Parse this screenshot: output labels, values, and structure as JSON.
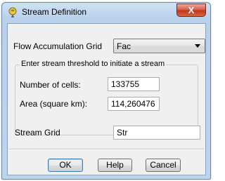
{
  "window": {
    "title": "Stream Definition",
    "close_symbol": "X",
    "icon": "globe-pin-icon",
    "colors": {
      "close_red": "#c8432c",
      "titlebar": "#bcd4ec",
      "client": "#f0f0f0"
    }
  },
  "flow_accumulation": {
    "label": "Flow Accumulation Grid",
    "selected": "Fac"
  },
  "threshold_group": {
    "legend": "Enter stream threshold to initiate a stream",
    "cells_label": "Number of cells:",
    "cells_value": "133755",
    "area_label": "Area (square km):",
    "area_value": "114,260476"
  },
  "stream_grid": {
    "label": "Stream Grid",
    "value": "Str"
  },
  "buttons": {
    "ok": "OK",
    "help": "Help",
    "cancel": "Cancel"
  }
}
